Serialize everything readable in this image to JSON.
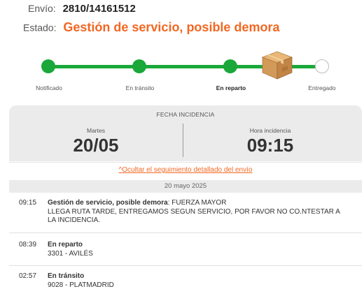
{
  "header": {
    "envio_label": "Envío:",
    "envio_value": "2810/14161512",
    "estado_label": "Estado:",
    "estado_value": "Gestión de servicio, posible demora"
  },
  "tracker": {
    "steps": [
      {
        "label": "Notificado",
        "state": "done"
      },
      {
        "label": "En tránsito",
        "state": "done"
      },
      {
        "label": "En reparto",
        "state": "current"
      },
      {
        "label": "Entregado",
        "state": "pending"
      }
    ],
    "current_icon": "package-box-icon",
    "color_done": "#1aa83a",
    "color_pending": "#bdbdbd"
  },
  "incidencia": {
    "title": "FECHA INCIDENCIA",
    "day_label": "Martes",
    "date_value": "20/05",
    "time_label": "Hora incidencia",
    "time_value": "09:15"
  },
  "toggle_link": "^Ocultar el seguimiento detallado del envío",
  "history": {
    "date": "20 mayo 2025",
    "events": [
      {
        "time": "09:15",
        "title": "Gestión de servicio, posible demora",
        "detail_inline": ": FUERZA MAYOR",
        "detail": "LLEGA RUTA TARDE, ENTREGAMOS SEGUN SERVICIO, POR FAVOR NO CO.NTESTAR A LA INCIDENCIA."
      },
      {
        "time": "08:39",
        "title": "En reparto",
        "detail_inline": "",
        "detail": "3301 - AVILÉS"
      },
      {
        "time": "02:57",
        "title": "En tránsito",
        "detail_inline": "",
        "detail": "9028 - PLATMADRID"
      }
    ]
  },
  "colors": {
    "accent": "#f26722",
    "success": "#1aa83a",
    "panel": "#ebebeb"
  }
}
